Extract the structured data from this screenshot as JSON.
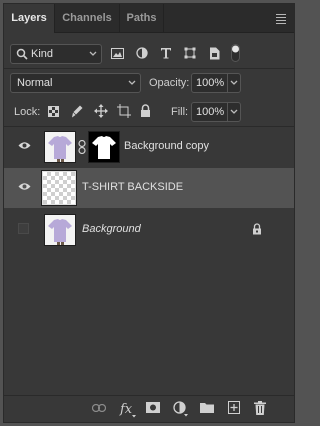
{
  "tabs": [
    {
      "label": "Layers",
      "active": true
    },
    {
      "label": "Channels",
      "active": false
    },
    {
      "label": "Paths",
      "active": false
    }
  ],
  "filter": {
    "kind_label": "Kind",
    "icons": [
      "image-filter-icon",
      "adjustment-filter-icon",
      "type-filter-icon",
      "shape-filter-icon",
      "smart-object-filter-icon",
      "filter-toggle-icon"
    ]
  },
  "blend": {
    "mode": "Normal",
    "opacity_label": "Opacity:",
    "opacity_value": "100%"
  },
  "lock": {
    "label": "Lock:",
    "icons": [
      "lock-transparent-icon",
      "lock-image-icon",
      "lock-position-icon",
      "lock-artboard-icon",
      "lock-all-icon"
    ],
    "fill_label": "Fill:",
    "fill_value": "100%"
  },
  "layers": [
    {
      "name": "Background copy",
      "visible": true,
      "selected": false,
      "has_mask": true,
      "locked": false
    },
    {
      "name": "T-SHIRT BACKSIDE",
      "visible": true,
      "selected": true,
      "has_mask": false,
      "locked": false
    },
    {
      "name": "Background",
      "visible": false,
      "selected": false,
      "has_mask": false,
      "locked": true
    }
  ],
  "footer_icons": [
    "link-layers-icon",
    "fx-icon",
    "add-mask-icon",
    "adjustment-layer-icon",
    "group-folder-icon",
    "new-layer-icon",
    "trash-icon"
  ],
  "colors": {
    "panel_bg": "#383838",
    "selected_row": "#535353",
    "tab_bar": "#2b2b2b",
    "shirt": "#b7a9d8"
  }
}
